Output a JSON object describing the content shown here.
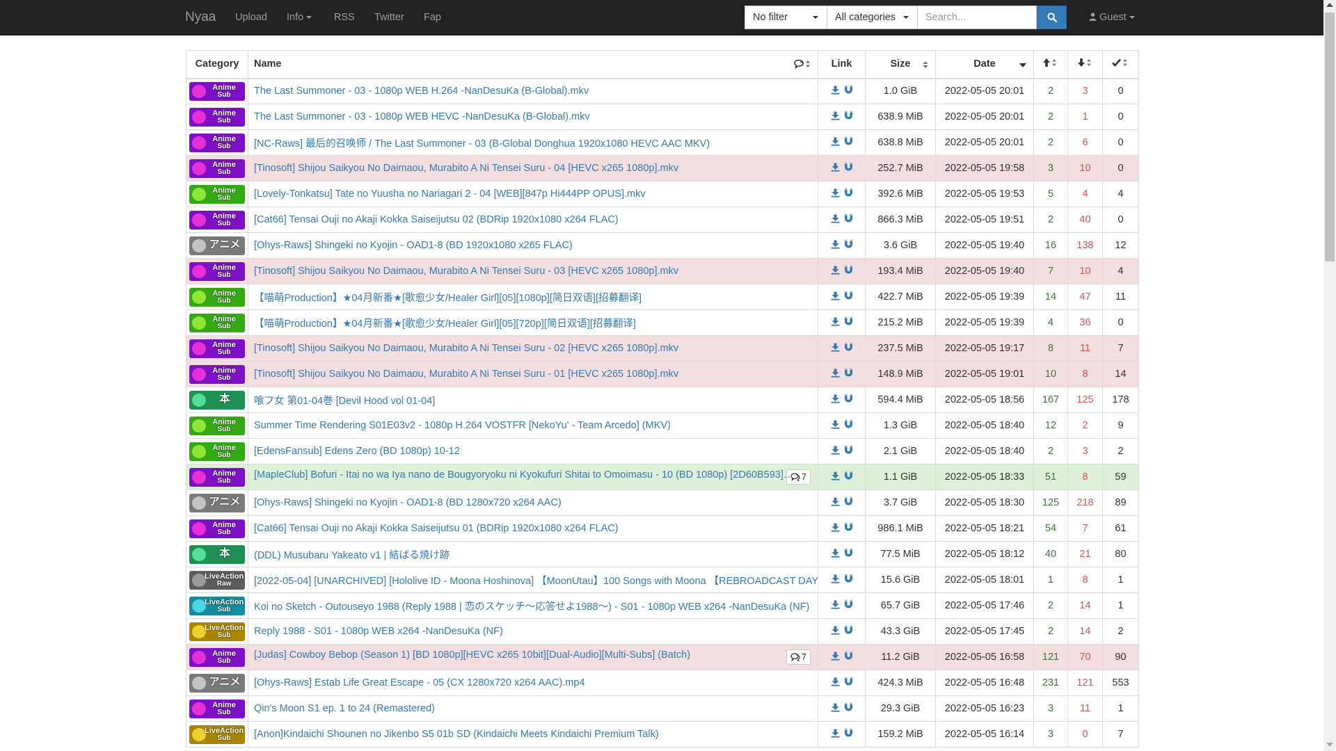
{
  "navbar": {
    "brand": "Nyaa",
    "links": [
      "Upload",
      "Info",
      "RSS",
      "Twitter",
      "Fap"
    ],
    "filter_value": "No filter",
    "category_value": "All categories",
    "search_placeholder": "Search...",
    "user_label": "Guest"
  },
  "table": {
    "headers": {
      "category": "Category",
      "name": "Name",
      "link": "Link",
      "size": "Size",
      "date": "Date"
    },
    "rows": [
      {
        "cat": "anime-sub",
        "status": "default",
        "name": "The Last Summoner - 03 - 1080p WEB H.264 -NanDesuKa (B-Global).mkv",
        "comments": "",
        "size": "1.0 GiB",
        "date": "2022-05-05 20:01",
        "seeders": "2",
        "leechers": "3",
        "completed": "0"
      },
      {
        "cat": "anime-sub",
        "status": "default",
        "name": "The Last Summoner - 03 - 1080p WEB HEVC -NanDesuKa (B-Global).mkv",
        "comments": "",
        "size": "638.9 MiB",
        "date": "2022-05-05 20:01",
        "seeders": "2",
        "leechers": "1",
        "completed": "0"
      },
      {
        "cat": "anime-sub",
        "status": "default",
        "name": "[NC-Raws] 最后的召唤师 / The Last Summoner - 03 (B-Global Donghua 1920x1080 HEVC AAC MKV)",
        "comments": "",
        "size": "638.8 MiB",
        "date": "2022-05-05 20:01",
        "seeders": "2",
        "leechers": "6",
        "completed": "0"
      },
      {
        "cat": "anime-sub",
        "status": "danger",
        "name": "[Tinosoft] Shijou Saikyou No Daimaou, Murabito A Ni Tensei Suru - 04 [HEVC x265 1080p].mkv",
        "comments": "",
        "size": "252.7 MiB",
        "date": "2022-05-05 19:58",
        "seeders": "3",
        "leechers": "10",
        "completed": "0"
      },
      {
        "cat": "anime-sub-green",
        "status": "default",
        "name": "[Lovely-Tonkatsu] Tate no Yuusha no Nariagari 2 - 04 [WEB][847p Hi444PP OPUS].mkv",
        "comments": "",
        "size": "392.6 MiB",
        "date": "2022-05-05 19:53",
        "seeders": "5",
        "leechers": "4",
        "completed": "4"
      },
      {
        "cat": "anime-sub",
        "status": "default",
        "name": "[Cat66] Tensai Ouji no Akaji Kokka Saiseijutsu 02 (BDRip 1920x1080 x264 FLAC)",
        "comments": "",
        "size": "866.3 MiB",
        "date": "2022-05-05 19:51",
        "seeders": "2",
        "leechers": "40",
        "completed": "0"
      },
      {
        "cat": "anime-raw",
        "status": "default",
        "name": "[Ohys-Raws] Shingeki no Kyojin - OAD1-8 (BD 1920x1080 x265 FLAC)",
        "comments": "",
        "size": "3.6 GiB",
        "date": "2022-05-05 19:40",
        "seeders": "16",
        "leechers": "138",
        "completed": "12"
      },
      {
        "cat": "anime-sub",
        "status": "danger",
        "name": "[Tinosoft] Shijou Saikyou No Daimaou, Murabito A Ni Tensei Suru - 03 [HEVC x265 1080p].mkv",
        "comments": "",
        "size": "193.4 MiB",
        "date": "2022-05-05 19:40",
        "seeders": "7",
        "leechers": "10",
        "completed": "4"
      },
      {
        "cat": "anime-sub-green",
        "status": "default",
        "name": "【喵萌Production】★04月新番★[歌愈少女/Healer Girl][05][1080p][简日双语][招募翻译]",
        "comments": "",
        "size": "422.7 MiB",
        "date": "2022-05-05 19:39",
        "seeders": "14",
        "leechers": "47",
        "completed": "11"
      },
      {
        "cat": "anime-sub-green",
        "status": "default",
        "name": "【喵萌Production】★04月新番★[歌愈少女/Healer Girl][05][720p][简日双语][招募翻译]",
        "comments": "",
        "size": "215.2 MiB",
        "date": "2022-05-05 19:39",
        "seeders": "4",
        "leechers": "36",
        "completed": "0"
      },
      {
        "cat": "anime-sub",
        "status": "danger",
        "name": "[Tinosoft] Shijou Saikyou No Daimaou, Murabito A Ni Tensei Suru - 02 [HEVC x265 1080p].mkv",
        "comments": "",
        "size": "237.5 MiB",
        "date": "2022-05-05 19:17",
        "seeders": "8",
        "leechers": "11",
        "completed": "7"
      },
      {
        "cat": "anime-sub",
        "status": "danger",
        "name": "[Tinosoft] Shijou Saikyou No Daimaou, Murabito A Ni Tensei Suru - 01 [HEVC x265 1080p].mkv",
        "comments": "",
        "size": "148.9 MiB",
        "date": "2022-05-05 19:01",
        "seeders": "10",
        "leechers": "8",
        "completed": "14"
      },
      {
        "cat": "literature",
        "status": "default",
        "name": "喰フ女 第01-04巻 [Devil Hood vol 01-04]",
        "comments": "",
        "size": "594.4 MiB",
        "date": "2022-05-05 18:56",
        "seeders": "167",
        "leechers": "125",
        "completed": "178"
      },
      {
        "cat": "anime-sub-green",
        "status": "default",
        "name": "Summer Time Rendering S01E03v2 - 1080p H.264 VOSTFR [NekoYu' - Team Arcedo] (MKV)",
        "comments": "",
        "size": "1.3 GiB",
        "date": "2022-05-05 18:40",
        "seeders": "12",
        "leechers": "2",
        "completed": "9"
      },
      {
        "cat": "anime-sub-green",
        "status": "default",
        "name": "[EdensFansub] Edens Zero (BD 1080p) 10-12",
        "comments": "",
        "size": "2.1 GiB",
        "date": "2022-05-05 18:40",
        "seeders": "2",
        "leechers": "3",
        "completed": "2"
      },
      {
        "cat": "anime-sub",
        "status": "success",
        "name": "[MapleClub] Bofuri - Itai no wa Iya nano de Bougyoryoku ni Kyokufuri Shitai to Omoimasu - 10 (BD 1080p) [2D60B593]…",
        "comments": "7",
        "size": "1.1 GiB",
        "date": "2022-05-05 18:33",
        "seeders": "51",
        "leechers": "8",
        "completed": "59"
      },
      {
        "cat": "anime-raw",
        "status": "default",
        "name": "[Ohys-Raws] Shingeki no Kyojin - OAD1-8 (BD 1280x720 x264 AAC)",
        "comments": "",
        "size": "3.7 GiB",
        "date": "2022-05-05 18:30",
        "seeders": "125",
        "leechers": "218",
        "completed": "89"
      },
      {
        "cat": "anime-sub",
        "status": "default",
        "name": "[Cat66] Tensai Ouji no Akaji Kokka Saiseijutsu 01 (BDRip 1920x1080 x264 FLAC)",
        "comments": "",
        "size": "986.1 MiB",
        "date": "2022-05-05 18:21",
        "seeders": "54",
        "leechers": "7",
        "completed": "61"
      },
      {
        "cat": "literature",
        "status": "default",
        "name": "(DDL) Musubaru Yakeato v1 | 結ばる焼け跡",
        "comments": "",
        "size": "77.5 MiB",
        "date": "2022-05-05 18:12",
        "seeders": "40",
        "leechers": "21",
        "completed": "80"
      },
      {
        "cat": "live-raw",
        "status": "default",
        "name": "[2022-05-04] [UNARCHIVED] [Hololive ID - Moona Hoshinova] 【MoonUtau】100 Songs with Moona 【REBROADCAST DAY…",
        "comments": "",
        "size": "15.6 GiB",
        "date": "2022-05-05 18:01",
        "seeders": "1",
        "leechers": "8",
        "completed": "1"
      },
      {
        "cat": "live-sub-teal",
        "status": "default",
        "name": "Koi no Sketch - Outouseyo 1988 (Reply 1988 | 恋のスケッチ～応答せよ1988～) - S01 - 1080p WEB x264 -NanDesuKa (NF)",
        "comments": "",
        "size": "65.7 GiB",
        "date": "2022-05-05 17:46",
        "seeders": "2",
        "leechers": "14",
        "completed": "1"
      },
      {
        "cat": "live-sub",
        "status": "default",
        "name": "Reply 1988 - S01 - 1080p WEB x264 -NanDesuKa (NF)",
        "comments": "",
        "size": "43.3 GiB",
        "date": "2022-05-05 17:45",
        "seeders": "2",
        "leechers": "14",
        "completed": "2"
      },
      {
        "cat": "anime-sub",
        "status": "danger",
        "name": "[Judas] Cowboy Bebop (Season 1) [BD 1080p][HEVC x265 10bit][Dual-Audio][Multi-Subs] (Batch)",
        "comments": "7",
        "size": "11.2 GiB",
        "date": "2022-05-05 16:58",
        "seeders": "121",
        "leechers": "70",
        "completed": "90"
      },
      {
        "cat": "anime-raw",
        "status": "default",
        "name": "[Ohys-Raws] Estab Life Great Escape - 05 (CX 1280x720 x264 AAC).mp4",
        "comments": "",
        "size": "424.3 MiB",
        "date": "2022-05-05 16:48",
        "seeders": "231",
        "leechers": "121",
        "completed": "553"
      },
      {
        "cat": "anime-sub",
        "status": "default",
        "name": "Qin's Moon S1 ep. 1 to 24 (Remastered)",
        "comments": "",
        "size": "29.3 GiB",
        "date": "2022-05-05 16:23",
        "seeders": "3",
        "leechers": "11",
        "completed": "1"
      },
      {
        "cat": "live-sub",
        "status": "default",
        "name": "[Anon]Kindaichi Shounen no Jikenbo S5 01b SD (Kindaichi Meets Kindaichi Premium Talk)",
        "comments": "",
        "size": "159.2 MiB",
        "date": "2022-05-05 16:14",
        "seeders": "3",
        "leechers": "0",
        "completed": "7"
      }
    ]
  },
  "categories": {
    "anime-sub": {
      "icon": "anime-sub-icon",
      "line1": "Anime",
      "line2": "Sub",
      "bg": "#7d10c4",
      "blob": "#ff3ad9"
    },
    "anime-sub-green": {
      "icon": "anime-sub-icon",
      "line1": "Anime",
      "line2": "Sub",
      "bg": "#33aa14",
      "blob": "#a6f53d"
    },
    "anime-raw": {
      "icon": "anime-raw-icon",
      "line1": "アニメ",
      "line2": "",
      "bg": "#7a7a7a",
      "blob": "#d7d7d7"
    },
    "literature": {
      "icon": "literature-icon",
      "line1": "本",
      "line2": "",
      "bg": "#1f8f55",
      "blob": "#5ff3a8"
    },
    "live-raw": {
      "icon": "live-action-raw-icon",
      "line1": "LiveAction",
      "line2": "Raw",
      "bg": "#5c5c5c",
      "blob": "#aaaaaa"
    },
    "live-sub-teal": {
      "icon": "live-action-sub-icon",
      "line1": "LiveAction",
      "line2": "Sub",
      "bg": "#148c9c",
      "blob": "#59e9f5"
    },
    "live-sub": {
      "icon": "live-action-sub-icon",
      "line1": "LiveAction",
      "line2": "Sub",
      "bg": "#a98500",
      "blob": "#ffe23d"
    }
  },
  "colors": {
    "navbar": "#222222",
    "link": "#337ab7",
    "seeders": "#3c763d",
    "leechers": "#d9534f",
    "danger_row": "#f2dede",
    "success_row": "#dff0d8"
  }
}
